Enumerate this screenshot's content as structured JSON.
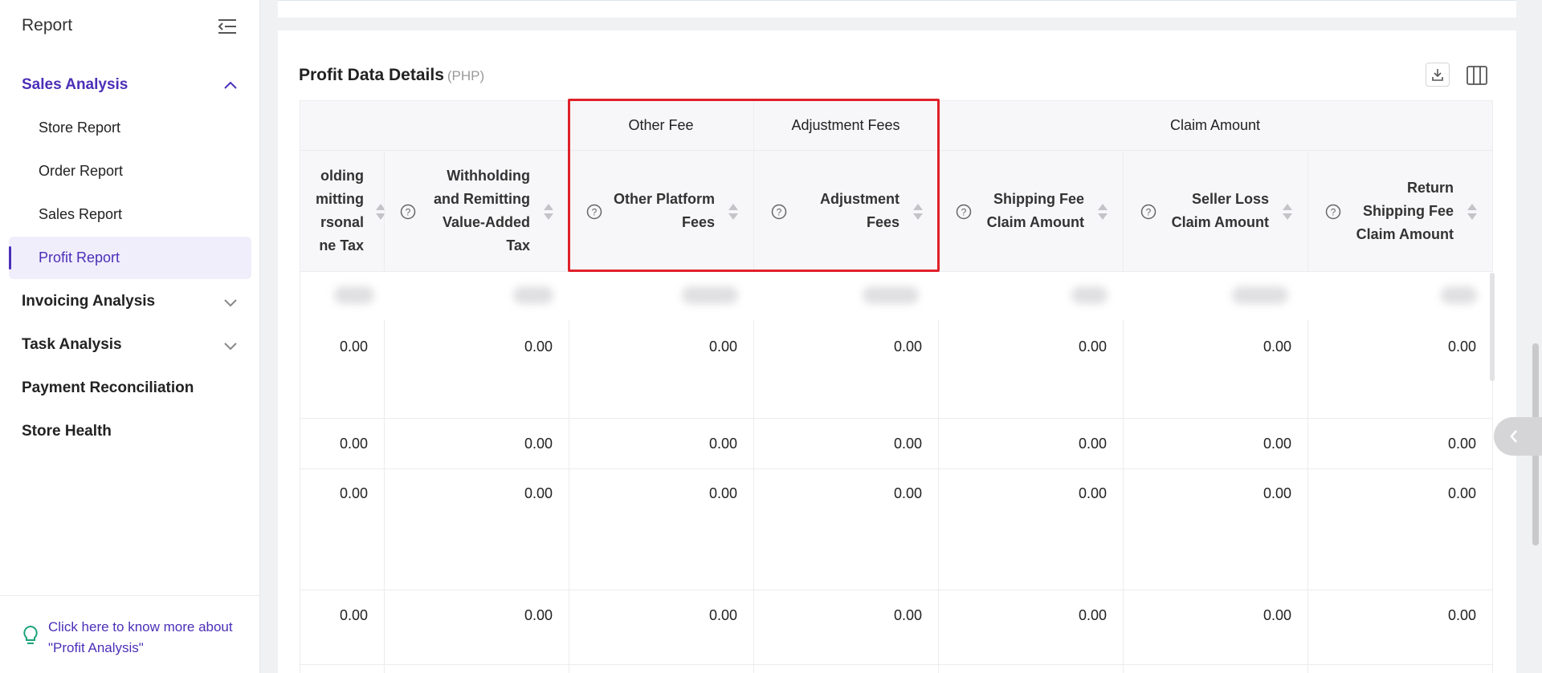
{
  "sidebar": {
    "title": "Report",
    "groups": [
      {
        "label": "Sales Analysis",
        "expanded": true
      },
      {
        "label": "Invoicing Analysis",
        "expanded": false
      },
      {
        "label": "Task Analysis",
        "expanded": false
      },
      {
        "label": "Payment Reconciliation"
      },
      {
        "label": "Store Health"
      }
    ],
    "sales_items": [
      "Store Report",
      "Order Report",
      "Sales Report",
      "Profit Report"
    ],
    "active_item": "Profit Report",
    "footer_link": "Click here to know more about \"Profit Analysis\""
  },
  "card": {
    "title": "Profit Data Details",
    "currency": "(PHP)"
  },
  "table": {
    "group_headers": {
      "other_fee": "Other Fee",
      "adjustment_fees": "Adjustment Fees",
      "claim_amount": "Claim Amount"
    },
    "columns": [
      "olding\nmitting\nrsonal\nne Tax",
      "Withholding\nand Remitting\nValue-Added\nTax",
      "Other Platform\nFees",
      "Adjustment\nFees",
      "Shipping Fee\nClaim Amount",
      "Seller Loss\nClaim Amount",
      "Return\nShipping Fee\nClaim Amount"
    ],
    "rows": [
      [
        "0.00",
        "0.00",
        "0.00",
        "0.00",
        "0.00",
        "0.00",
        "0.00"
      ],
      [
        "0.00",
        "0.00",
        "0.00",
        "0.00",
        "0.00",
        "0.00",
        "0.00"
      ],
      [
        "0.00",
        "0.00",
        "0.00",
        "0.00",
        "0.00",
        "0.00",
        "0.00"
      ],
      [
        "0.00",
        "0.00",
        "0.00",
        "0.00",
        "0.00",
        "0.00",
        "0.00"
      ]
    ]
  },
  "colors": {
    "accent": "#4b2fb8",
    "highlight": "#e0202a"
  }
}
